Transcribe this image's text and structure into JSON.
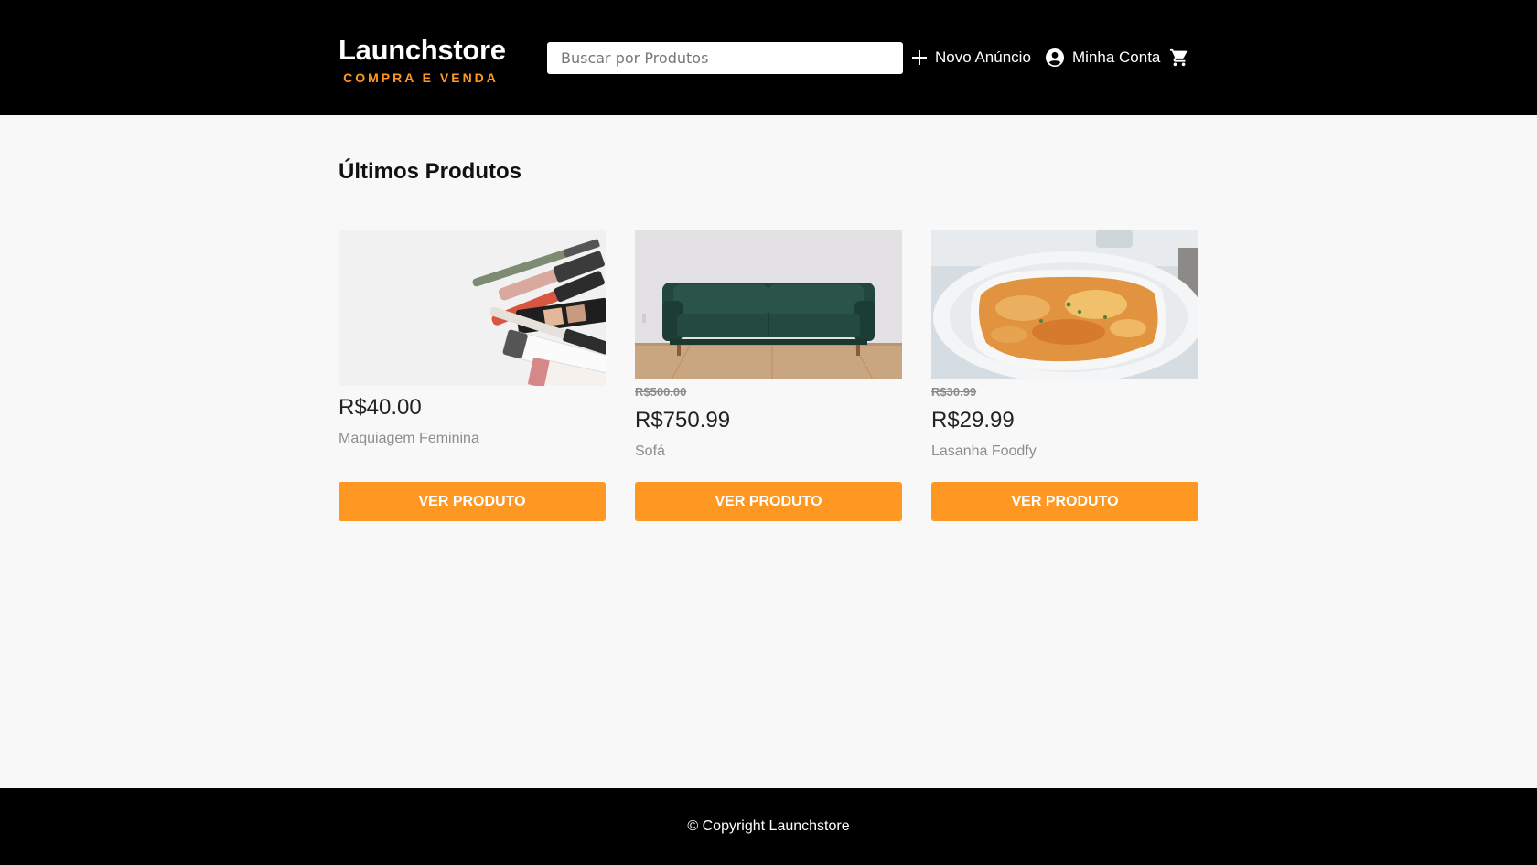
{
  "header": {
    "logo_title": "Launchstore",
    "logo_subtitle": "COMPRA E VENDA",
    "search_placeholder": "Buscar por Produtos",
    "nav": {
      "new_listing": "Novo Anúncio",
      "my_account": "Minha Conta"
    }
  },
  "main": {
    "title": "Últimos Produtos",
    "products": [
      {
        "name": "Maquiagem Feminina",
        "old_price": "",
        "price": "R$40.00",
        "button": "Ver Produto"
      },
      {
        "name": "Sofá",
        "old_price": "R$500.00",
        "price": "R$750.99",
        "button": "Ver Produto"
      },
      {
        "name": "Lasanha Foodfy",
        "old_price": "R$30.99",
        "price": "R$29.99",
        "button": "Ver Produto"
      }
    ]
  },
  "footer": {
    "copyright": "© Copyright Launchstore"
  },
  "colors": {
    "header_bg": "#000000",
    "accent": "#ff9822",
    "page_bg": "#f8f8f8"
  },
  "icons": [
    "plus-icon",
    "account-circle-icon",
    "shopping-cart-icon"
  ]
}
